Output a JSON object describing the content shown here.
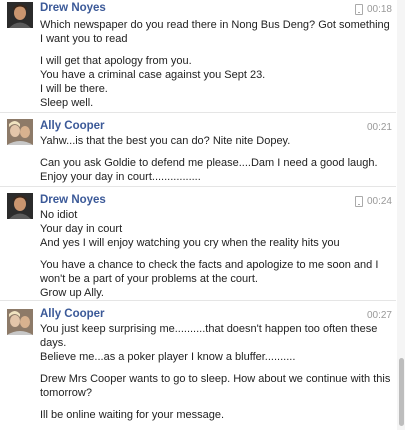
{
  "messages": [
    {
      "sender": "Drew Noyes",
      "time": "00:18",
      "mobile": true,
      "avatar": "drew-noyes-avatar",
      "paragraphs": [
        [
          "Which newspaper do you read there in Nong Bus Deng? Got something",
          "I want you to read"
        ],
        [
          "I will get that apology  from you.",
          "You have a criminal case against you Sept 23.",
          "I will be there.",
          "Sleep well."
        ]
      ]
    },
    {
      "sender": "Ally Cooper",
      "time": "00:21",
      "mobile": false,
      "avatar": "ally-cooper-avatar",
      "paragraphs": [
        [
          "Yahw...is that the best you can do? Nite nite Dopey."
        ],
        [
          "Can you ask Goldie to defend me please....Dam I need a good laugh.",
          "Enjoy your day in court................"
        ]
      ]
    },
    {
      "sender": "Drew Noyes",
      "time": "00:24",
      "mobile": true,
      "avatar": "drew-noyes-avatar",
      "paragraphs": [
        [
          "No idiot",
          "Your day in court",
          "And yes I will enjoy watching you cry when the reality hits you"
        ],
        [
          "You have a chance to check the facts and apologize to me soon and I",
          "won't be a part of your problems at the court.",
          "Grow up Ally."
        ]
      ]
    },
    {
      "sender": "Ally Cooper",
      "time": "00:27",
      "mobile": false,
      "avatar": "ally-cooper-avatar",
      "paragraphs": [
        [
          "You just keep surprising me..........that doesn't happen too often these",
          "days.",
          "Believe me...as a poker player I know a bluffer.........."
        ],
        [
          "Drew Mrs Cooper wants to go to sleep. How about we continue with this",
          "tomorrow?"
        ],
        [
          "Ill be online waiting for your message."
        ]
      ]
    }
  ]
}
